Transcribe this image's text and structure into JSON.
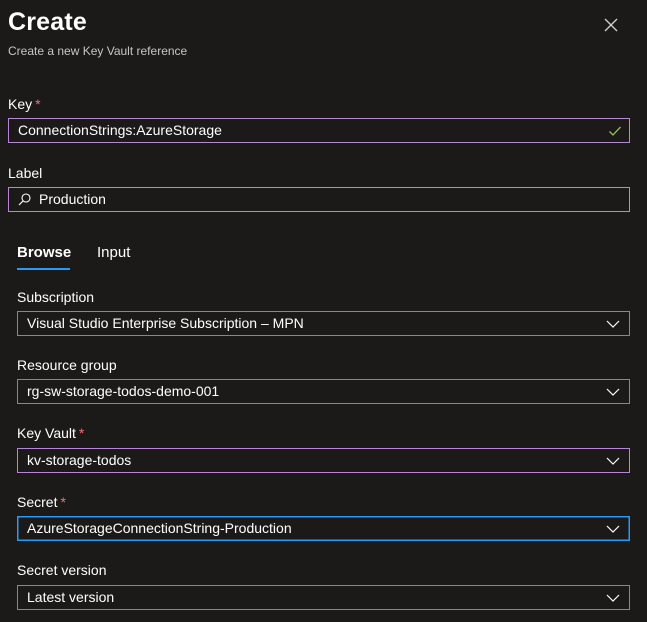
{
  "header": {
    "title": "Create",
    "subtitle": "Create a new Key Vault reference"
  },
  "key": {
    "label": "Key",
    "required_mark": "*",
    "value": "ConnectionStrings:AzureStorage"
  },
  "label_field": {
    "label": "Label",
    "value": "Production"
  },
  "tabs": [
    {
      "label": "Browse",
      "active": true
    },
    {
      "label": "Input",
      "active": false
    }
  ],
  "subscription": {
    "label": "Subscription",
    "value": "Visual Studio Enterprise Subscription – MPN"
  },
  "resource_group": {
    "label": "Resource group",
    "value": "rg-sw-storage-todos-demo-001"
  },
  "key_vault": {
    "label": "Key Vault",
    "required_mark": "*",
    "value": "kv-storage-todos"
  },
  "secret": {
    "label": "Secret",
    "required_mark": "*",
    "value": "AzureStorageConnectionString-Production"
  },
  "secret_version": {
    "label": "Secret version",
    "value": "Latest version"
  },
  "colors": {
    "background": "#1b1a19",
    "accent": "#2899f5",
    "required": "#f1707b",
    "valid_check": "#92c353",
    "purple_focus": "#b587d4"
  },
  "icons": {
    "close": "close-icon",
    "check": "check-icon",
    "search": "search-icon",
    "chevron": "chevron-down-icon"
  }
}
